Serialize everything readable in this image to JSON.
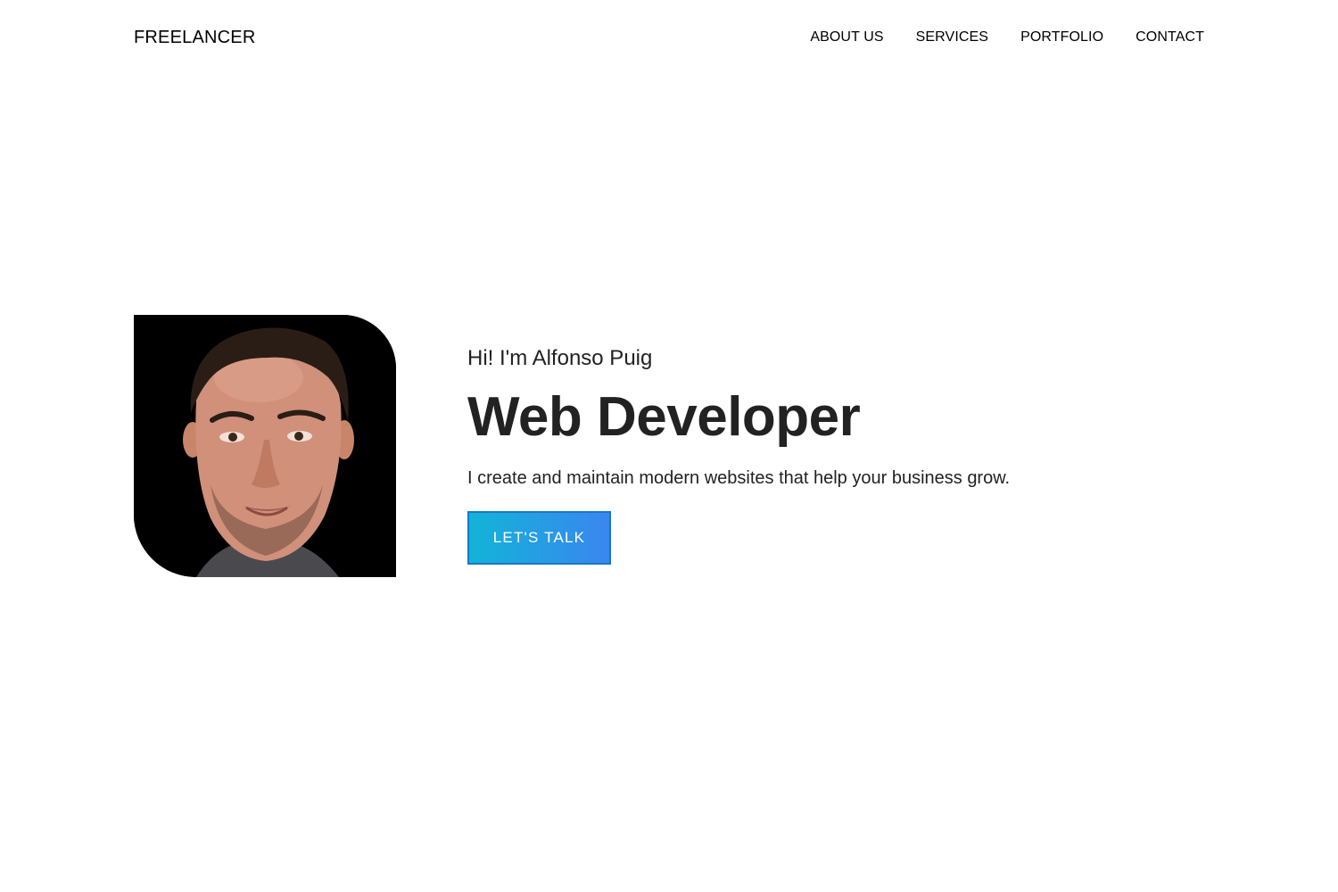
{
  "header": {
    "logo": "FREELANCER",
    "nav": [
      {
        "label": "ABOUT US"
      },
      {
        "label": "SERVICES"
      },
      {
        "label": "PORTFOLIO"
      },
      {
        "label": "CONTACT"
      }
    ]
  },
  "hero": {
    "portrait_icon": "person-photo",
    "greeting": "Hi! I'm Alfonso Puig",
    "role": "Web Developer",
    "tagline": "I create and maintain modern websites that help your business grow.",
    "cta_label": "LET'S TALK"
  },
  "colors": {
    "cta_gradient_start": "#12b4d8",
    "cta_gradient_end": "#3a86f0",
    "cta_border": "#1878c8",
    "text": "#222222"
  }
}
